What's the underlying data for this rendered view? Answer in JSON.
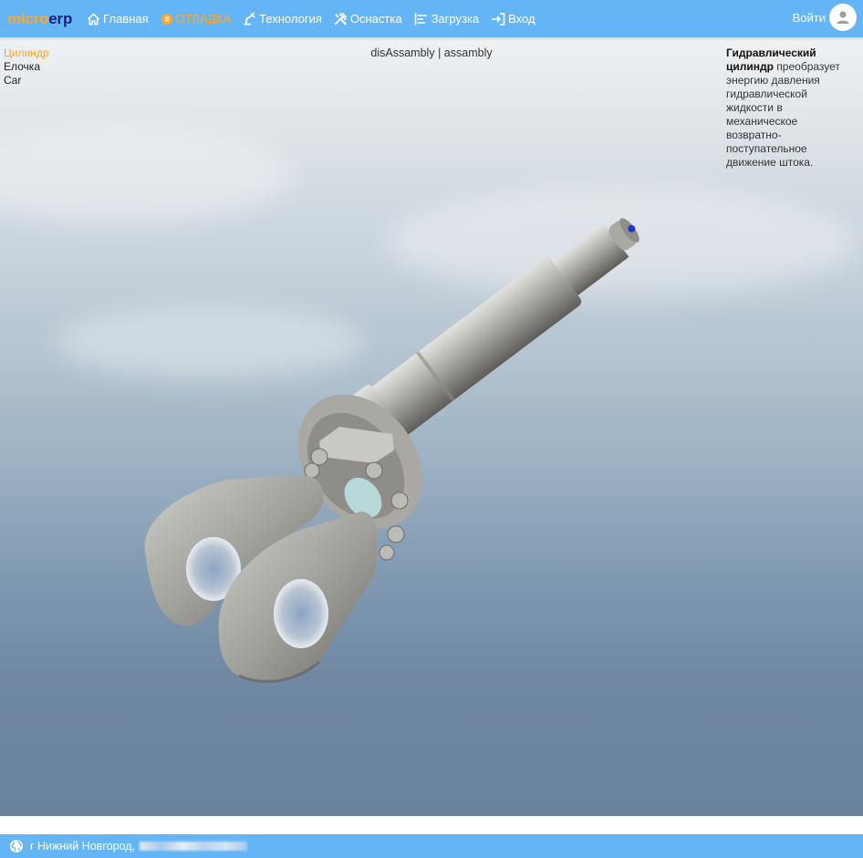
{
  "header": {
    "logo": {
      "part1": "micro",
      "part2": "erp"
    },
    "nav": [
      {
        "label": "Главная",
        "icon": "home-icon"
      },
      {
        "label": "ОТЛАДКА",
        "icon": "debug-icon"
      },
      {
        "label": "Технология",
        "icon": "robot-arm-icon"
      },
      {
        "label": "Оснастка",
        "icon": "tools-icon"
      },
      {
        "label": "Загрузка",
        "icon": "gantt-icon"
      },
      {
        "label": "Вход",
        "icon": "login-icon"
      }
    ],
    "login_label": "Войти"
  },
  "viewer": {
    "models": [
      "Цилиндр",
      "Елочка",
      "Car"
    ],
    "active_model": "Цилиндр",
    "modes": {
      "disassembly": "disAssambly",
      "separator": "|",
      "assembly": "assambly"
    },
    "description": {
      "title": "Гидравлический цилиндр",
      "text": "преобразует энергию давления гидравлической жидкости в механическое возвратно-поступательное движение штока."
    }
  },
  "footer": {
    "location": "г Нижний Новгород,"
  },
  "colors": {
    "accent": "#64b5f6",
    "orange": "#ffa726",
    "logo_dark": "#1a237e"
  }
}
